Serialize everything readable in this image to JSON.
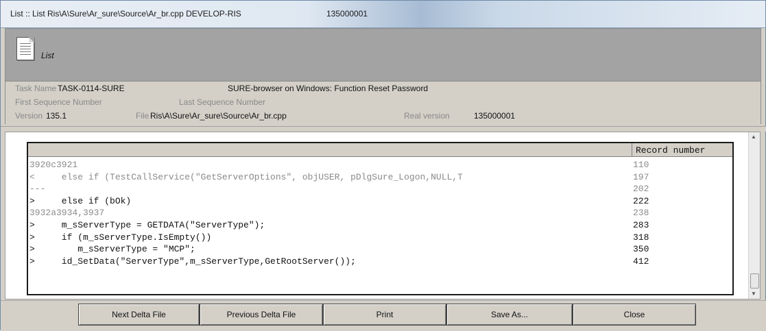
{
  "window": {
    "title": "List :: List Ris\\A\\Sure\\Ar_sure\\Source\\Ar_br.cpp DEVELOP-RIS",
    "title_number": "135000001"
  },
  "header": {
    "icon": "document-icon",
    "label": "List"
  },
  "info": {
    "task_name_label": "Task Name",
    "task_name_value": "TASK-0114-SURE",
    "task_desc": "SURE-browser on Windows: Function Reset Password",
    "first_seq_label": "First Sequence Number",
    "last_seq_label": "Last Sequence Number",
    "version_label": "Version",
    "version_value": "135.1",
    "file_label": "File",
    "file_value": "Ris\\A\\Sure\\Ar_sure\\Source\\Ar_br.cpp",
    "real_version_label": "Real version",
    "real_version_value": "135000001"
  },
  "grid": {
    "column_header": "Record number",
    "rows": [
      {
        "code": "3920c3921",
        "record": "110",
        "style": "gray"
      },
      {
        "code": "<     else if (TestCallService(\"GetServerOptions\", objUSER, pDlgSure_Logon,NULL,T",
        "record": "197",
        "style": "gray"
      },
      {
        "code": "---",
        "record": "202",
        "style": "gray"
      },
      {
        "code": ">     else if (bOk)",
        "record": "222",
        "style": "dark"
      },
      {
        "code": "3932a3934,3937",
        "record": "238",
        "style": "gray"
      },
      {
        "code": ">     m_sServerType = GETDATA(\"ServerType\");",
        "record": "283",
        "style": "dark"
      },
      {
        "code": ">     if (m_sServerType.IsEmpty())",
        "record": "318",
        "style": "dark"
      },
      {
        "code": ">        m_sServerType = \"MCP\";",
        "record": "350",
        "style": "dark"
      },
      {
        "code": ">     id_SetData(\"ServerType\",m_sServerType,GetRootServer());",
        "record": "412",
        "style": "dark"
      }
    ]
  },
  "scrollbar": {
    "up_icon": "arrow-up-icon",
    "down_icon": "arrow-down-icon"
  },
  "buttons": {
    "next_delta": "Next Delta File",
    "prev_delta": "Previous Delta File",
    "print": "Print",
    "save_as": "Save As...",
    "close": "Close"
  }
}
